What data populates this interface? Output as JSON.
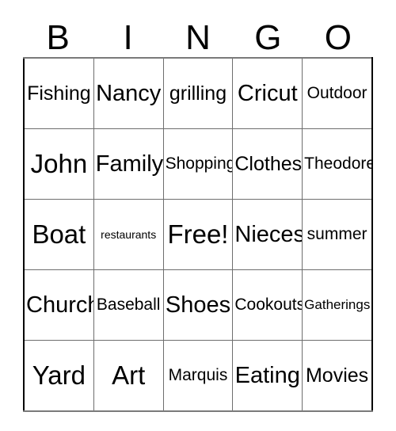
{
  "card": {
    "header_letters": [
      "B",
      "I",
      "N",
      "G",
      "O"
    ],
    "free_space_label": "Free!",
    "border_color": "#6e6e6e",
    "text_color": "#000000",
    "background_color": "#ffffff",
    "rows": [
      [
        {
          "text": "Fishing",
          "size": "fs-lg"
        },
        {
          "text": "Nancy",
          "size": "fs-xl"
        },
        {
          "text": "grilling",
          "size": "fs-lg"
        },
        {
          "text": "Cricut",
          "size": "fs-xl"
        },
        {
          "text": "Outdoor",
          "size": "fs-md"
        }
      ],
      [
        {
          "text": "John",
          "size": "fs-xxl"
        },
        {
          "text": "Family",
          "size": "fs-xl"
        },
        {
          "text": "Shopping",
          "size": "fs-md"
        },
        {
          "text": "Clothes",
          "size": "fs-lg"
        },
        {
          "text": "Theodore",
          "size": "fs-md"
        }
      ],
      [
        {
          "text": "Boat",
          "size": "fs-xxl"
        },
        {
          "text": "restaurants",
          "size": "fs-xs"
        },
        {
          "text": "Free!",
          "size": "fs-xxl"
        },
        {
          "text": "Nieces",
          "size": "fs-xl"
        },
        {
          "text": "summer",
          "size": "fs-md"
        }
      ],
      [
        {
          "text": "Church",
          "size": "fs-xl"
        },
        {
          "text": "Baseball",
          "size": "fs-md"
        },
        {
          "text": "Shoes",
          "size": "fs-xl"
        },
        {
          "text": "Cookouts",
          "size": "fs-md"
        },
        {
          "text": "Gatherings",
          "size": "fs-sm"
        }
      ],
      [
        {
          "text": "Yard",
          "size": "fs-xxl"
        },
        {
          "text": "Art",
          "size": "fs-xxl"
        },
        {
          "text": "Marquis",
          "size": "fs-md"
        },
        {
          "text": "Eating",
          "size": "fs-xl"
        },
        {
          "text": "Movies",
          "size": "fs-lg"
        }
      ]
    ]
  }
}
